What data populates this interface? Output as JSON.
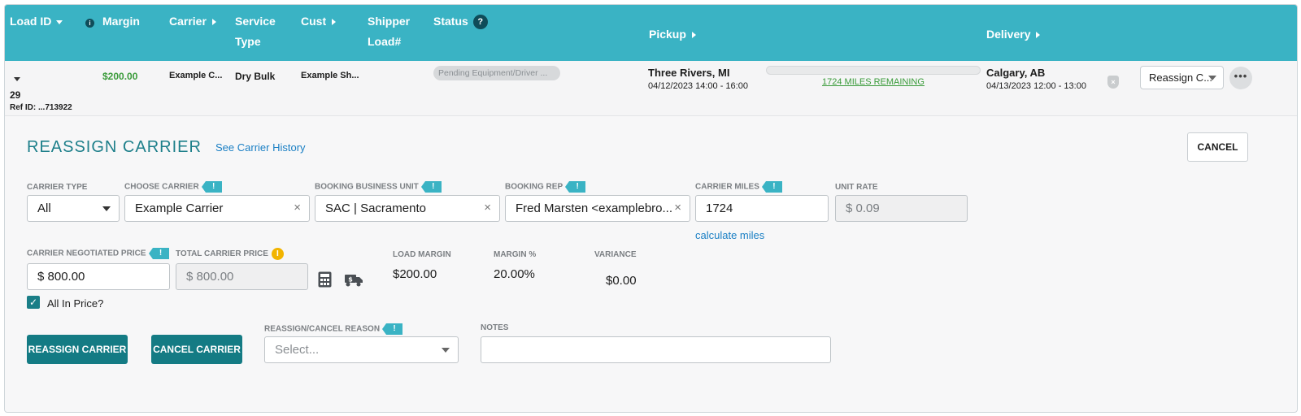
{
  "header": {
    "load_id": "Load ID",
    "margin": "Margin",
    "carrier": "Carrier",
    "service_line1": "Service",
    "service_line2": "Type",
    "cust": "Cust",
    "shipper_line1": "Shipper",
    "shipper_line2": "Load#",
    "status": "Status",
    "pickup": "Pickup",
    "delivery": "Delivery"
  },
  "row": {
    "load_num": "29",
    "ref_id": "Ref ID: ...713922",
    "margin": "$200.00",
    "carrier": "Example C...",
    "service_type": "Dry Bulk",
    "customer": "Example Sh...",
    "status": "Pending Equipment/Driver ...",
    "pickup_city": "Three Rivers, MI",
    "pickup_time": "04/12/2023 14:00 - 16:00",
    "miles_remaining": "1724 MILES REMAINING",
    "miles_progress": 0,
    "delivery_city": "Calgary, AB",
    "delivery_time": "04/13/2023 12:00 - 13:00",
    "action_select": "Reassign C...",
    "more": "•••"
  },
  "panel": {
    "title": "REASSIGN CARRIER",
    "history_link": "See Carrier History",
    "cancel_button": "CANCEL",
    "carrier_type_label": "CARRIER TYPE",
    "carrier_type_value": "All",
    "choose_carrier_label": "CHOOSE CARRIER",
    "choose_carrier_value": "Example Carrier",
    "booking_unit_label": "BOOKING BUSINESS UNIT",
    "booking_unit_value": "SAC | Sacramento",
    "booking_rep_label": "BOOKING REP",
    "booking_rep_value": "Fred Marsten <examplebro...",
    "carrier_miles_label": "CARRIER MILES",
    "carrier_miles_value": "1724",
    "calc_miles_link": "calculate miles",
    "unit_rate_label": "UNIT RATE",
    "unit_rate_value": "$ 0.09",
    "negotiated_label": "CARRIER NEGOTIATED PRICE",
    "negotiated_value": "$ 800.00",
    "total_price_label": "TOTAL CARRIER PRICE",
    "total_price_value": "$ 800.00",
    "load_margin_label": "LOAD MARGIN",
    "load_margin_value": "$200.00",
    "margin_pct_label": "MARGIN %",
    "margin_pct_value": "20.00%",
    "variance_label": "VARIANCE",
    "variance_value": "$0.00",
    "all_in_label": "All In Price?",
    "all_in_checked": true,
    "reassign_button": "REASSIGN CARRIER",
    "cancel_carrier_button": "CANCEL CARRIER",
    "reason_label": "REASSIGN/CANCEL REASON",
    "reason_placeholder": "Select...",
    "notes_label": "NOTES",
    "notes_value": "",
    "flag_glyph": "!",
    "info_glyph": "i",
    "question_glyph": "?",
    "check_glyph": "✓",
    "clear_glyph": "×"
  },
  "colors": {
    "header_bg": "#3ab3c4",
    "accent_teal": "#147b84",
    "margin_green": "#3a9b3a",
    "link_blue": "#1a7fc4",
    "warning_yellow": "#f2b400"
  }
}
